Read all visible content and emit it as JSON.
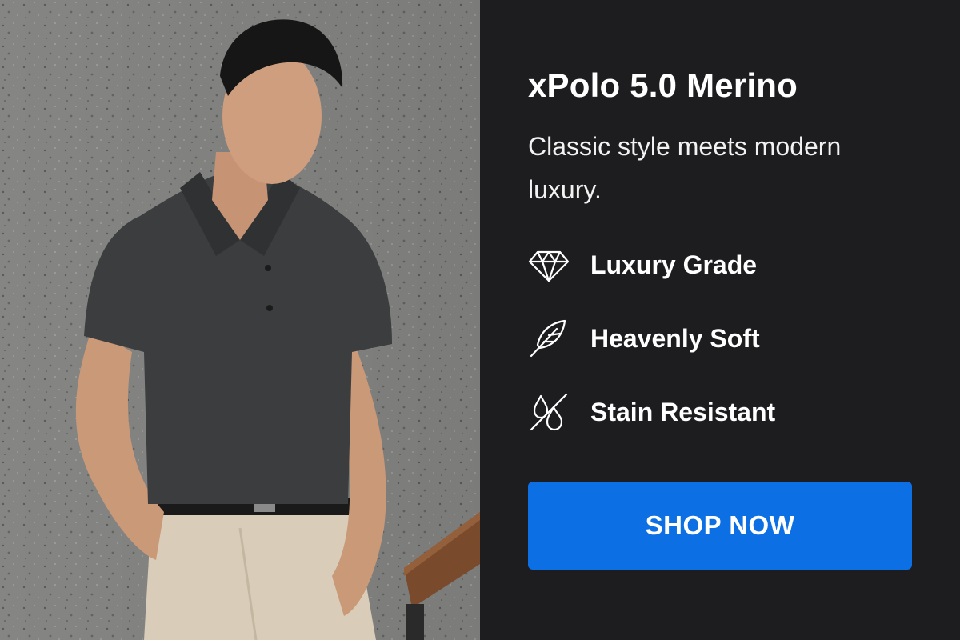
{
  "product": {
    "title": "xPolo 5.0 Merino",
    "subtitle": "Classic style meets modern luxury."
  },
  "features": [
    {
      "label": "Luxury Grade",
      "icon": "diamond-icon"
    },
    {
      "label": "Heavenly Soft",
      "icon": "feather-icon"
    },
    {
      "label": "Stain Resistant",
      "icon": "stain-resistant-icon"
    }
  ],
  "cta": {
    "label": "SHOP NOW"
  },
  "colors": {
    "panel_background": "#1d1d20",
    "cta_background": "#0c6fe3",
    "text": "#ffffff"
  }
}
